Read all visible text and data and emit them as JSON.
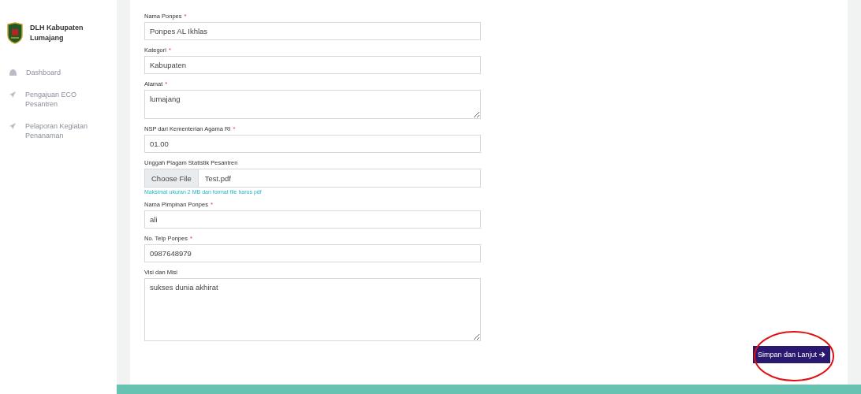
{
  "sidebar": {
    "brand": "DLH Kabupaten Lumajang",
    "items": [
      {
        "label": "Dashboard",
        "kind": "home",
        "selected": false
      },
      {
        "label": "Pengajuan ECO Pesantren",
        "kind": "send",
        "selected": false
      },
      {
        "label": "Pelaporan Kegiatan Penanaman",
        "kind": "send",
        "selected": false
      }
    ]
  },
  "form": {
    "fields": [
      {
        "label": "Nama Ponpes",
        "required_mark": "*",
        "kind": "text",
        "value": "Ponpes AL Ikhlas"
      },
      {
        "label": "Kategori",
        "required_mark": "*",
        "kind": "text",
        "value": "Kabupaten"
      },
      {
        "label": "Alamat",
        "required_mark": "*",
        "kind": "textarea",
        "value": "lumajang"
      },
      {
        "label": "NSP dari Kementerian Agama RI",
        "required_mark": "*",
        "kind": "text",
        "value": "01.00"
      },
      {
        "label": "Unggah Piagam Statistik Pesantren",
        "kind": "file",
        "button": "Choose File",
        "value": "Test.pdf",
        "hint": "Maksimal ukuran 2 MB dan format file harus pdf"
      },
      {
        "label": "Nama Pimpinan Ponpes",
        "required_mark": "*",
        "kind": "text",
        "value": "ali"
      },
      {
        "label": "No. Telp Ponpes",
        "required_mark": "*",
        "kind": "text",
        "value": "0987648979"
      },
      {
        "label": "Visi dan Misi",
        "kind": "bigtextarea",
        "value": "sukses dunia akhirat"
      }
    ],
    "submit": {
      "label": "Simpan dan Lanjut",
      "circled": true
    }
  }
}
